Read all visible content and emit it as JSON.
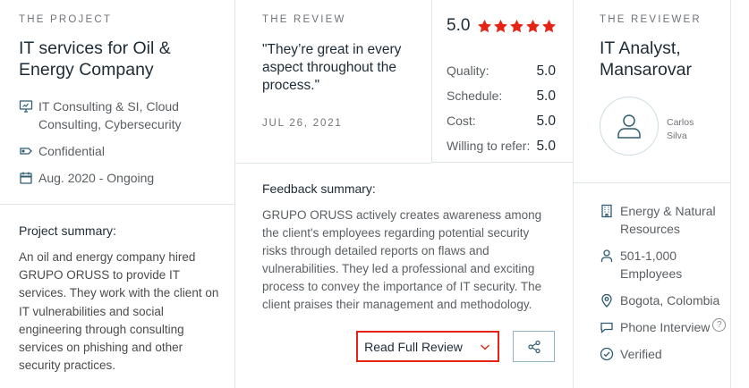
{
  "project": {
    "eyebrow": "THE PROJECT",
    "title_line1": "IT services for Oil &",
    "title_line2": "Energy Company",
    "services_line1": "IT Consulting & SI, Cloud",
    "services_line2": "Consulting, Cybersecurity",
    "budget": "Confidential",
    "dates": "Aug. 2020 - Ongoing",
    "summary_label": "Project summary:",
    "summary_text": "An oil and energy company hired GRUPO ORUSS to provide IT services. They work with the client on IT vulnerabilities and social engineering through consulting services on phishing and other security practices."
  },
  "review": {
    "eyebrow": "THE REVIEW",
    "quote": "\"They’re great in every aspect throughout the process.\"",
    "date": "JUL 26, 2021",
    "overall": "5.0",
    "stars": 5,
    "ratings": [
      {
        "label": "Quality:",
        "value": "5.0"
      },
      {
        "label": "Schedule:",
        "value": "5.0"
      },
      {
        "label": "Cost:",
        "value": "5.0"
      },
      {
        "label": "Willing to refer:",
        "value": "5.0"
      }
    ],
    "feedback_label": "Feedback summary:",
    "feedback_text": "GRUPO ORUSS actively creates awareness among the client's employees regarding potential security risks through detailed reports on flaws and vulnerabilities. They led a professional and exciting process to convey the importance of IT security. The client praises their management and methodology.",
    "read_full_label": "Read Full Review"
  },
  "reviewer": {
    "eyebrow": "THE REVIEWER",
    "title_line1": "IT Analyst,",
    "title_line2": "Mansarovar",
    "name_line1": "Carlos",
    "name_line2": "Silva",
    "industry_line1": "Energy & Natural",
    "industry_line2": "Resources",
    "size_line1": "501-1,000",
    "size_line2": "Employees",
    "location": "Bogota, Colombia",
    "review_type": "Phone Interview",
    "help_symbol": "?",
    "verified": "Verified"
  },
  "colors": {
    "star": "#e62415",
    "button_border": "#e62415",
    "share_border": "#8fb3c4",
    "icon": "#2e5c73"
  }
}
